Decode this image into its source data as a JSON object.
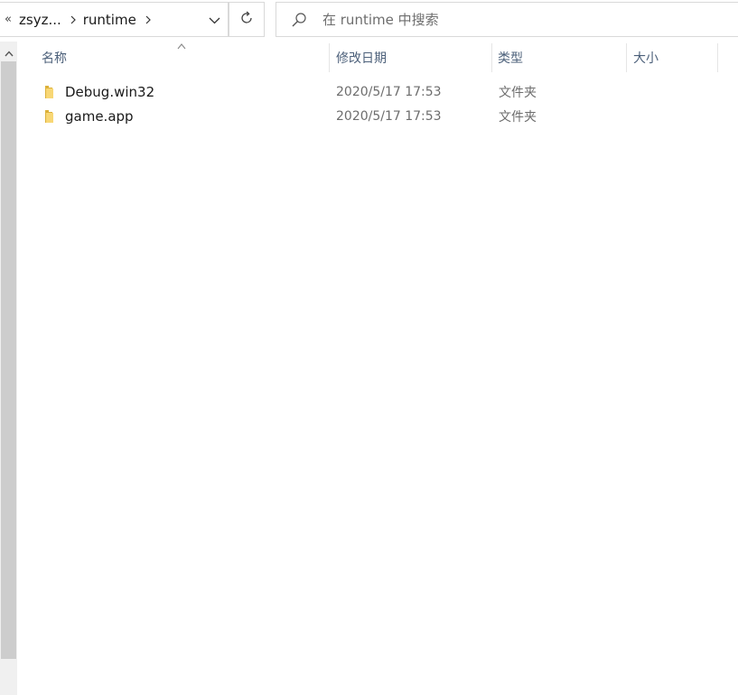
{
  "address_bar": {
    "overflow_glyph": "«",
    "crumbs": [
      "zsyz...",
      "runtime"
    ]
  },
  "search": {
    "placeholder": "在 runtime 中搜索"
  },
  "columns": {
    "name": "名称",
    "date": "修改日期",
    "type": "类型",
    "size": "大小"
  },
  "files": [
    {
      "name": "Debug.win32",
      "modified": "2020/5/17 17:53",
      "type": "文件夹",
      "size": ""
    },
    {
      "name": "game.app",
      "modified": "2020/5/17 17:53",
      "type": "文件夹",
      "size": ""
    }
  ],
  "colors": {
    "folder": "#f5c542",
    "header_text": "#4c607a",
    "scroll_thumb": "#cdcdcd"
  }
}
